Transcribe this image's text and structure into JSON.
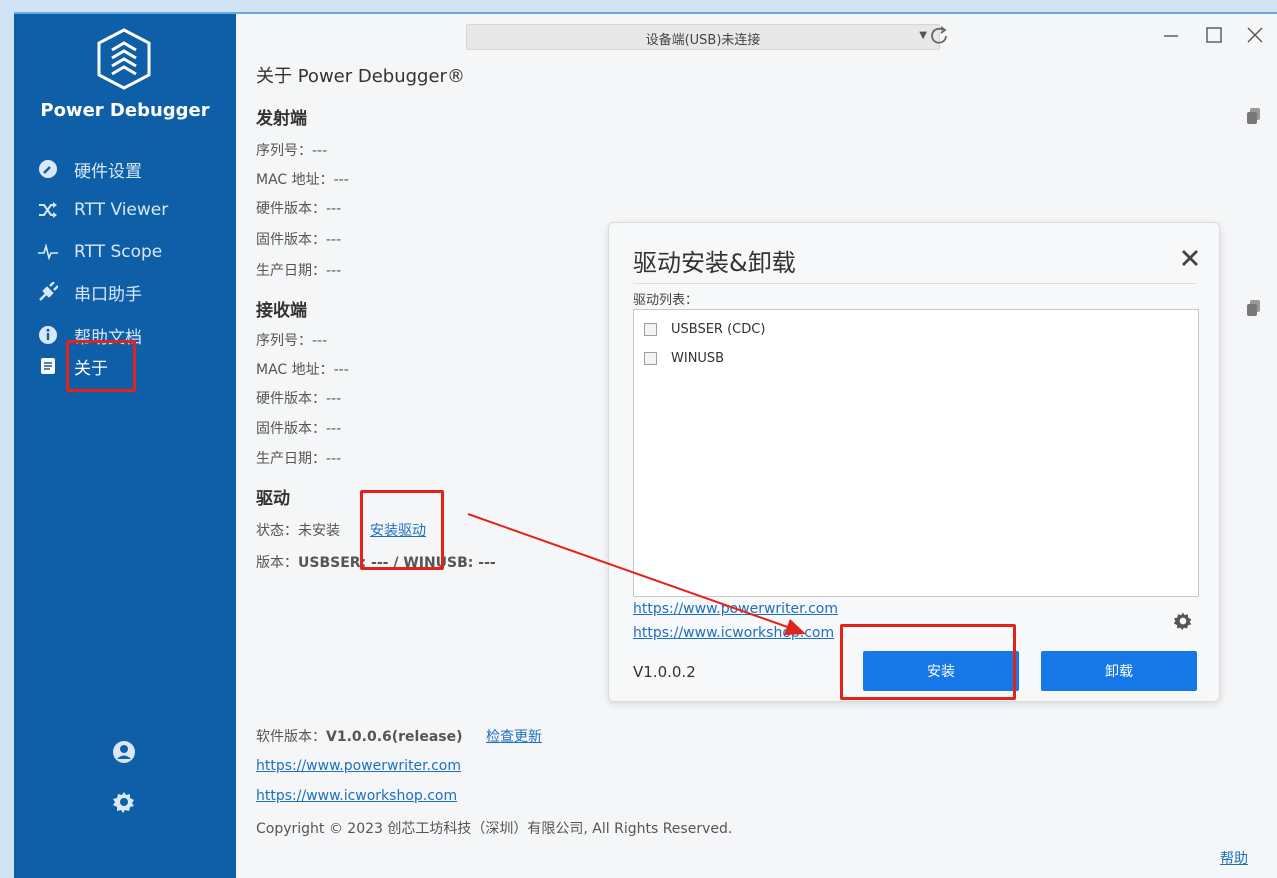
{
  "app": {
    "name": "Power Debugger"
  },
  "sidebar": {
    "items": [
      {
        "label": "硬件设置",
        "icon": "wrench-icon"
      },
      {
        "label": "RTT Viewer",
        "icon": "shuffle-icon"
      },
      {
        "label": "RTT Scope",
        "icon": "pulse-icon"
      },
      {
        "label": "串口助手",
        "icon": "plug-icon"
      },
      {
        "label": "帮助文档",
        "icon": "info-icon"
      },
      {
        "label": "关于",
        "icon": "document-icon"
      }
    ]
  },
  "topbar": {
    "device_status": "设备端(USB)未连接"
  },
  "about": {
    "title": "关于 Power Debugger®",
    "transmitter": {
      "heading": "发射端",
      "rows": [
        "序列号：---",
        "MAC 地址：---",
        "硬件版本：---",
        "固件版本：---",
        "生产日期：---"
      ]
    },
    "receiver": {
      "heading": "接收端",
      "rows": [
        "序列号：---",
        "MAC 地址：---",
        "硬件版本：---",
        "固件版本：---",
        "生产日期：---"
      ]
    },
    "driver": {
      "heading": "驱动",
      "status_label": "状态：未安装",
      "install_link": "安装驱动",
      "version_prefix": "版本：",
      "version_value": "USBSER: --- / WINUSB: ---"
    },
    "footer": {
      "software_version_label": "软件版本：",
      "software_version": "V1.0.0.6(release)",
      "check_update": "检查更新",
      "link1": "https://www.powerwriter.com",
      "link2": "https://www.icworkshop.com",
      "copyright": "Copyright © 2023 创芯工坊科技（深圳）有限公司, All Rights Reserved.",
      "help": "帮助"
    }
  },
  "dialog": {
    "title": "驱动安装&卸载",
    "list_label": "驱动列表：",
    "drivers": [
      "USBSER (CDC)",
      "WINUSB"
    ],
    "link1": "https://www.powerwriter.com",
    "link2": "https://www.icworkshop.com",
    "version": "V1.0.0.2",
    "install_label": "安装",
    "uninstall_label": "卸载"
  },
  "colors": {
    "sidebar": "#0f5fa8",
    "accent": "#1677e6",
    "highlight": "#e2231a",
    "link": "#1f6fbf"
  }
}
